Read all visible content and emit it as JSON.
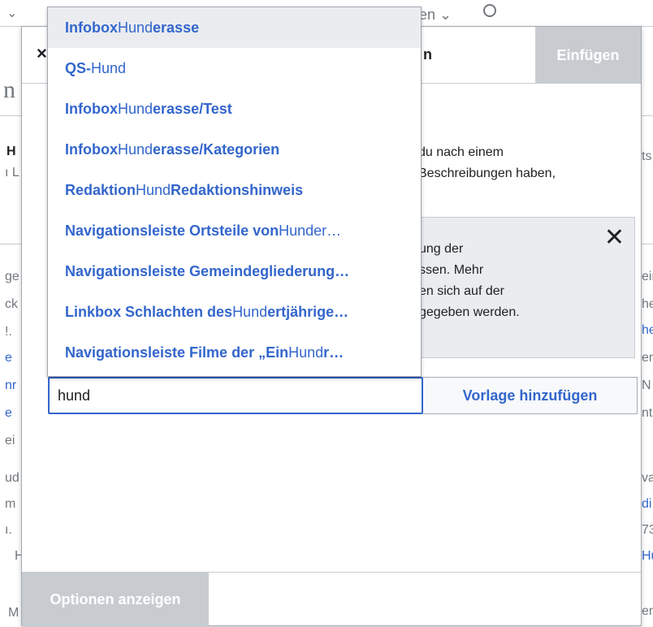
{
  "background": {
    "lang_fragment": "en",
    "fragments": [
      {
        "text": "n",
        "cls": "c-gray"
      },
      {
        "text": "H",
        "cls": "c-dark"
      },
      {
        "text": "ı L",
        "cls": "c-gray"
      },
      {
        "text": "ts",
        "cls": "c-gray"
      },
      {
        "text": "ge",
        "cls": "c-gray"
      },
      {
        "text": "ck",
        "cls": "c-gray"
      },
      {
        "text": "!.",
        "cls": "c-gray"
      },
      {
        "text": "e",
        "cls": "c-link"
      },
      {
        "text": "nr",
        "cls": "c-link"
      },
      {
        "text": "e",
        "cls": "c-link"
      },
      {
        "text": "ei",
        "cls": "c-gray"
      },
      {
        "text": "ud",
        "cls": "c-gray"
      },
      {
        "text": "m",
        "cls": "c-gray"
      },
      {
        "text": "ı.",
        "cls": "c-gray"
      },
      {
        "text": "H",
        "cls": "c-gray"
      },
      {
        "text": "eir",
        "cls": "c-gray"
      },
      {
        "text": "he",
        "cls": "c-gray"
      },
      {
        "text": "he",
        "cls": "c-link"
      },
      {
        "text": "en",
        "cls": "c-gray"
      },
      {
        "text": "N",
        "cls": "c-gray"
      },
      {
        "text": "nt",
        "cls": "c-gray"
      },
      {
        "text": "va",
        "cls": "c-gray"
      },
      {
        "text": "di",
        "cls": "c-link"
      },
      {
        "text": "73",
        "cls": "c-gray"
      },
      {
        "text": "Hu",
        "cls": "c-link"
      },
      {
        "text": "en",
        "cls": "c-gray"
      },
      {
        "text": "M",
        "cls": "c-gray"
      }
    ]
  },
  "dialog": {
    "close_icon": "×",
    "title_fragment": "n",
    "insert_label": "Einfügen",
    "description_lines": [
      "du nach einem",
      " Beschreibungen haben,"
    ],
    "notice": {
      "lines": [
        "ung der",
        "ssen. Mehr",
        "en sich auf der",
        "gegeben werden."
      ],
      "close_icon": "✕"
    },
    "search": {
      "value": "hund",
      "placeholder": ""
    },
    "add_label": "Vorlage hinzufügen",
    "options_label": "Optionen anzeigen"
  },
  "suggestions": [
    {
      "parts": [
        {
          "t": "Infobox",
          "b": true
        },
        {
          "t": " Hund",
          "b": false
        },
        {
          "t": "erasse",
          "b": true
        }
      ],
      "highlighted": true
    },
    {
      "parts": [
        {
          "t": "QS-",
          "b": true
        },
        {
          "t": "Hund",
          "b": false
        }
      ],
      "highlighted": false
    },
    {
      "parts": [
        {
          "t": "Infobox",
          "b": true
        },
        {
          "t": " Hund",
          "b": false
        },
        {
          "t": "erasse/Test",
          "b": true
        }
      ],
      "highlighted": false
    },
    {
      "parts": [
        {
          "t": "Infobox",
          "b": true
        },
        {
          "t": " Hund",
          "b": false
        },
        {
          "t": "erasse/Kategorien",
          "b": true
        }
      ],
      "highlighted": false
    },
    {
      "parts": [
        {
          "t": "Redaktion",
          "b": true
        },
        {
          "t": " Hund ",
          "b": false
        },
        {
          "t": "Redaktionshinweis",
          "b": true
        }
      ],
      "highlighted": false
    },
    {
      "parts": [
        {
          "t": "Navigationsleiste Ortsteile von",
          "b": true
        },
        {
          "t": " Hunder…",
          "b": false
        }
      ],
      "highlighted": false
    },
    {
      "parts": [
        {
          "t": "Navigationsleiste Gemeindegliederung…",
          "b": true
        }
      ],
      "highlighted": false
    },
    {
      "parts": [
        {
          "t": "Linkbox Schlachten des",
          "b": true
        },
        {
          "t": " Hund",
          "b": false
        },
        {
          "t": "ertjährige…",
          "b": true
        }
      ],
      "highlighted": false
    },
    {
      "parts": [
        {
          "t": "Navigationsleiste Filme der „Ein",
          "b": true
        },
        {
          "t": " Hund ",
          "b": false
        },
        {
          "t": "r…",
          "b": true
        }
      ],
      "highlighted": false
    }
  ]
}
